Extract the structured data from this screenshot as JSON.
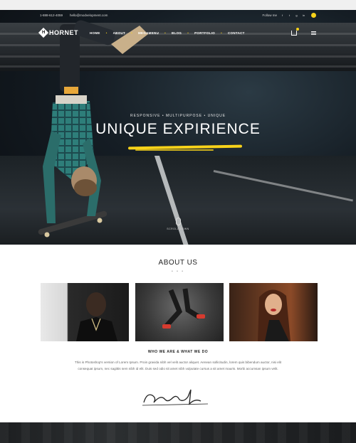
{
  "topbar": {
    "phone": "1-888-612-4059",
    "email": "hello@modvelopment.com",
    "follow_label": "Follow me",
    "social_icons": [
      "facebook-icon",
      "twitter-icon",
      "google-plus-icon",
      "linkedin-icon"
    ]
  },
  "nav": {
    "logo_mark": "H",
    "logo_text": "HORNET",
    "items": [
      "HOME",
      "ABOUT",
      "MEGAMENU",
      "BLOG",
      "PORTFOLIO",
      "CONTACT"
    ],
    "accent_color": "#f7d21a"
  },
  "hero": {
    "tagline": "RESPONSIVE  •  MULTIPURPOSE  •  UNIQUE",
    "headline": "UNIQUE EXPIRIENCE",
    "scroll_label": "SCROLL DOWN"
  },
  "about": {
    "title": "ABOUT US",
    "dots": "• • •",
    "subtitle": "WHO WE ARE & WHAT WE DO",
    "body": "This is Photoshop's version of Lorem Ipsum. Proin gravida nibh vel velit auctor aliquet. Aenean sollicitudin, lorem quis bibendum auctor, nisi elit consequat ipsum, nec sagittis sem nibh id elit. Duis sed odio sit amet nibh vulputate cursus a sit amet mauris. Morbi accumsan ipsum velit."
  }
}
